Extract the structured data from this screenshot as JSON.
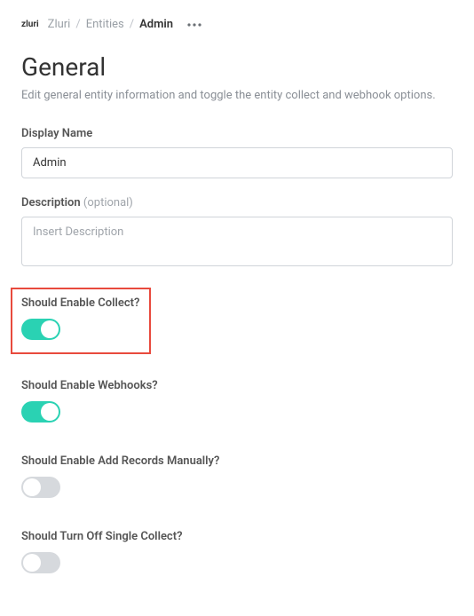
{
  "breadcrumb": {
    "logo": "zluri",
    "items": [
      "Zluri",
      "Entities",
      "Admin"
    ]
  },
  "header": {
    "title": "General",
    "subtitle": "Edit general entity information and toggle the entity collect and webhook options."
  },
  "fields": {
    "displayName": {
      "label": "Display Name",
      "value": "Admin"
    },
    "description": {
      "label": "Description",
      "optional": "(optional)",
      "placeholder": "Insert Description",
      "value": ""
    }
  },
  "toggles": {
    "enableCollect": {
      "label": "Should Enable Collect?",
      "on": true
    },
    "enableWebhooks": {
      "label": "Should Enable Webhooks?",
      "on": true
    },
    "addRecordsManually": {
      "label": "Should Enable Add Records Manually?",
      "on": false
    },
    "turnOffSingleCollect": {
      "label": "Should Turn Off Single Collect?",
      "on": false
    }
  }
}
